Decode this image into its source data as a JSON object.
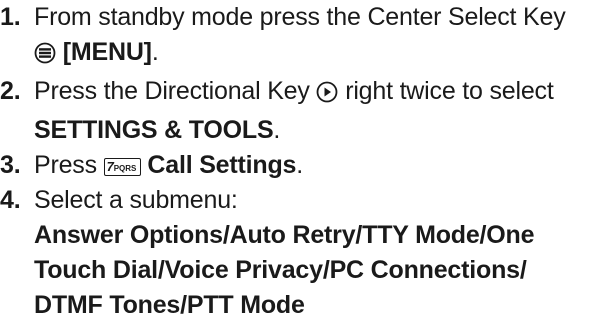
{
  "steps": [
    {
      "number": "1.",
      "text_a": "From standby mode press the Center Select Key",
      "icon": "center-select-key-icon",
      "text_b": "[MENU]",
      "text_c": "."
    },
    {
      "number": "2.",
      "text_a": "Press the Directional Key",
      "icon": "directional-key-right-icon",
      "text_b": "right twice to select",
      "text_c": "SETTINGS & TOOLS",
      "text_d": "."
    },
    {
      "number": "3.",
      "text_a": "Press",
      "key_digit": "7",
      "key_letters": "PQRS",
      "icon": "key-7pqrs-icon",
      "text_b": "Call Settings",
      "text_c": "."
    },
    {
      "number": "4.",
      "text_a": "Select a submenu:",
      "line_1": "Answer Options/Auto Retry/TTY Mode/One",
      "line_2": "Touch Dial/Voice Privacy/PC Connections/",
      "line_3": "DTMF Tones/PTT Mode"
    }
  ]
}
